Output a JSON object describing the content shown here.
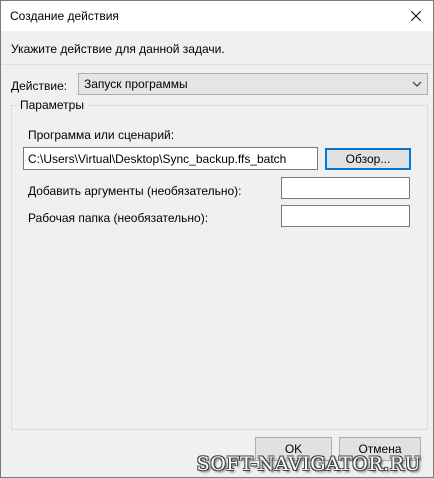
{
  "window": {
    "title": "Создание действия"
  },
  "prompt": "Укажите действие для данной задачи.",
  "action": {
    "label": "Действие:",
    "selected": "Запуск программы"
  },
  "params": {
    "legend": "Параметры",
    "program_label": "Программа или сценарий:",
    "program_value": "C:\\Users\\Virtual\\Desktop\\Sync_backup.ffs_batch",
    "browse_label": "Обзор...",
    "args_label": "Добавить аргументы (необязательно):",
    "args_value": "",
    "workdir_label": "Рабочая папка (необязательно):",
    "workdir_value": ""
  },
  "buttons": {
    "ok": "OK",
    "cancel": "Отмена"
  },
  "watermark": "SOFT-NAVIGATOR.RU",
  "icons": {
    "close": "close-icon",
    "dropdown": "chevron-down-icon"
  },
  "colors": {
    "focus_border": "#0078d7",
    "dialog_bg": "#f0f0f0"
  }
}
